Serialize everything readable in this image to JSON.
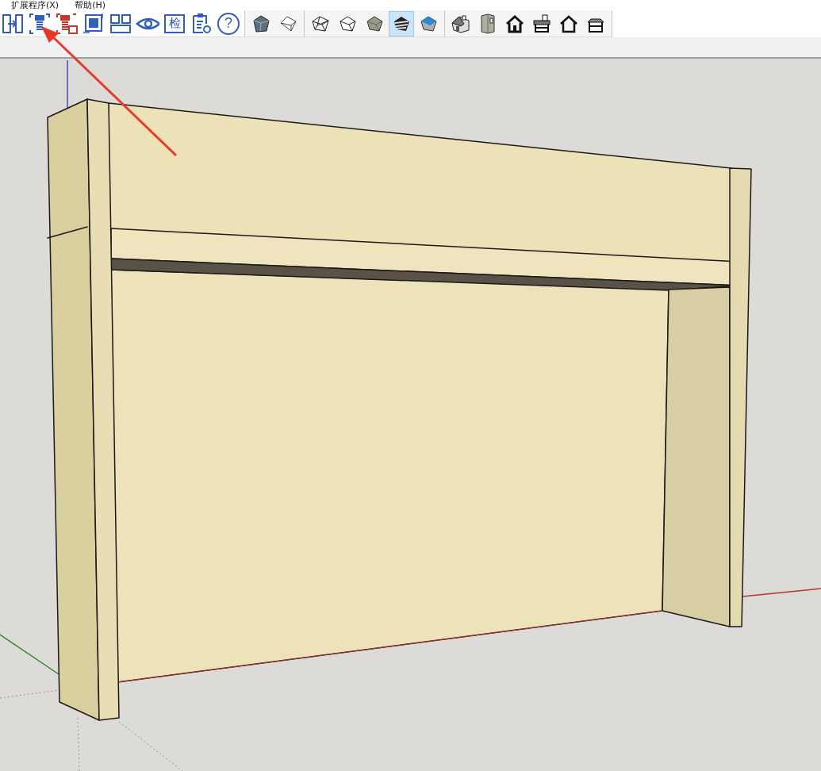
{
  "menu_bar": {
    "items": [
      "扩展程序(X)",
      "帮助(H)"
    ]
  },
  "toolbars": [
    {
      "buttons": [
        {
          "kind": "door"
        },
        {
          "kind": "screw"
        },
        {
          "kind": "screw-delete"
        },
        {
          "kind": "frame"
        },
        {
          "kind": "panels"
        },
        {
          "kind": "eye"
        },
        {
          "kind": "text-box",
          "label": "检"
        },
        {
          "kind": "report"
        },
        {
          "kind": "help",
          "label": "?"
        }
      ]
    },
    {
      "buttons": [
        {
          "kind": "cube-dark"
        },
        {
          "kind": "cube-light"
        }
      ]
    },
    {
      "buttons": [
        {
          "kind": "cube-wire",
          "selected": false
        },
        {
          "kind": "cube-hidden",
          "selected": false
        },
        {
          "kind": "cube-shaded",
          "selected": false
        },
        {
          "kind": "cube-textured",
          "selected": true
        },
        {
          "kind": "cube-mono",
          "selected": false
        }
      ]
    },
    {
      "buttons": [
        {
          "kind": "house-iso"
        },
        {
          "kind": "house-side"
        },
        {
          "kind": "house-front"
        },
        {
          "kind": "house-top"
        },
        {
          "kind": "house-outline"
        },
        {
          "kind": "house-flat"
        }
      ]
    }
  ]
}
